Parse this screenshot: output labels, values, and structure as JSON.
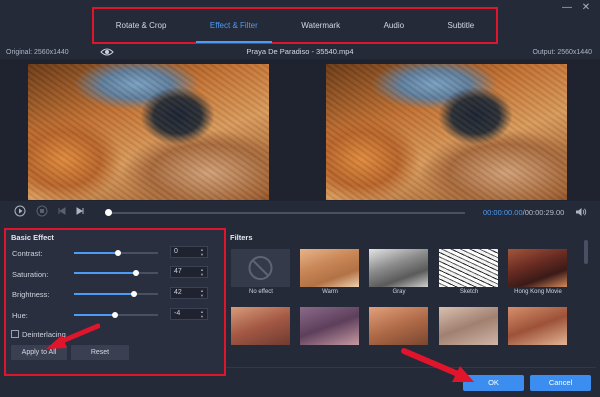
{
  "window": {
    "minimize_label": "—",
    "close_label": "✕"
  },
  "tabs": [
    {
      "label": "Rotate & Crop",
      "active": false
    },
    {
      "label": "Effect & Filter",
      "active": true
    },
    {
      "label": "Watermark",
      "active": false
    },
    {
      "label": "Audio",
      "active": false
    },
    {
      "label": "Subtitle",
      "active": false
    }
  ],
  "preview": {
    "original_label": "Original: 2560x1440",
    "output_label": "Output: 2560x1440",
    "filename": "Praya De Paradiso - 35540.mp4"
  },
  "playback": {
    "current_time": "00:00:00.00",
    "total_time": "/00:00:29.00",
    "progress": 0.0
  },
  "basic_effect": {
    "title": "Basic Effect",
    "adjustments": [
      {
        "label": "Contrast:",
        "value": "0",
        "level": 0.52
      },
      {
        "label": "Saturation:",
        "value": "47",
        "level": 0.74
      },
      {
        "label": "Brightness:",
        "value": "42",
        "level": 0.71
      },
      {
        "label": "Hue:",
        "value": "-4",
        "level": 0.49
      }
    ],
    "deinterlacing_label": "Deinterlacing",
    "deinterlacing_checked": false,
    "apply_all_label": "Apply to All",
    "reset_label": "Reset"
  },
  "filters": {
    "title": "Filters",
    "row1": [
      {
        "label": "No effect"
      },
      {
        "label": "Warm"
      },
      {
        "label": "Gray"
      },
      {
        "label": "Sketch"
      },
      {
        "label": "Hong Kong Movie"
      }
    ]
  },
  "footer": {
    "ok_label": "OK",
    "cancel_label": "Cancel"
  },
  "colors": {
    "accent": "#3b8ef0",
    "highlight_border": "#e0142b",
    "background": "#252a39"
  }
}
